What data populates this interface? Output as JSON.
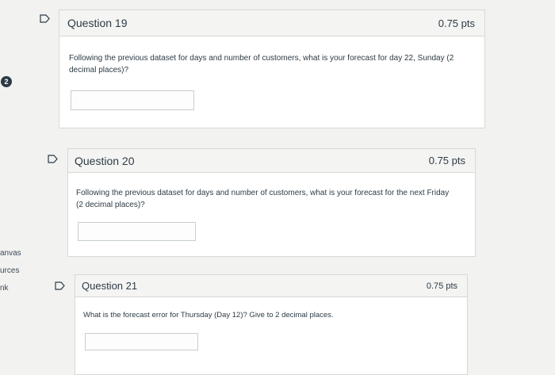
{
  "sidebar": {
    "badge_count": "2",
    "items": [
      {
        "label": "anvas"
      },
      {
        "label": "urces"
      },
      {
        "label": "nk"
      }
    ]
  },
  "questions": [
    {
      "title": "Question 19",
      "points": "0.75 pts",
      "text": "Following the previous dataset for days and number of customers, what is your forecast for day 22, Sunday (2 decimal places)?",
      "answer_value": ""
    },
    {
      "title": "Question 20",
      "points": "0.75 pts",
      "text": "Following the previous dataset for days and number of customers, what is your forecast for the next Friday (2 decimal places)?",
      "answer_value": ""
    },
    {
      "title": "Question 21",
      "points": "0.75 pts",
      "text": "What is the forecast error for Thursday (Day 12)? Give to 2 decimal places.",
      "answer_value": ""
    }
  ]
}
